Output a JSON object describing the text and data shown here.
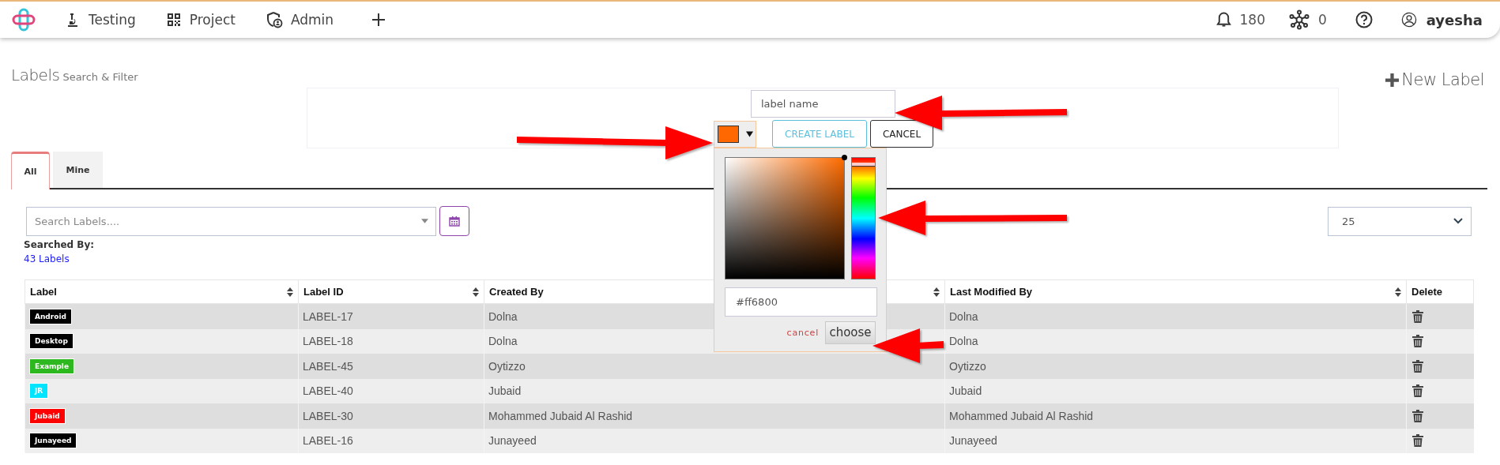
{
  "nav": {
    "items": [
      {
        "label": "Testing"
      },
      {
        "label": "Project"
      },
      {
        "label": "Admin"
      }
    ],
    "notifications": "180",
    "network_count": "0",
    "user": "ayesha"
  },
  "header": {
    "title": "Labels",
    "subtitle": "Search & Filter",
    "new_button": "New Label"
  },
  "create_form": {
    "name_field": {
      "placeholder": "label name"
    },
    "create_button": "CREATE LABEL",
    "cancel_button": "CANCEL"
  },
  "color_picker": {
    "value": "#ff6800",
    "hue_slider": {
      "level": 0.07
    },
    "cancel": "cancel",
    "choose": "choose"
  },
  "tabs": [
    {
      "label": "All",
      "selected": true
    },
    {
      "label": "Mine",
      "selected": false
    }
  ],
  "search": {
    "placeholder": "Search Labels...."
  },
  "per_page": "25",
  "searched_by": "Searched By:",
  "count_link": "43 Labels",
  "table": {
    "columns": [
      {
        "label": "Label",
        "sortable": true
      },
      {
        "label": "Label ID",
        "sortable": true
      },
      {
        "label": "Created By",
        "sortable": true
      },
      {
        "label": "Last Modified By",
        "sortable": true
      },
      {
        "label": "Delete",
        "sortable": false
      }
    ],
    "rows": [
      {
        "label": "Android",
        "color": "#000000",
        "id": "LABEL-17",
        "created_by": "Dolna",
        "modified_by": "Dolna"
      },
      {
        "label": "Desktop",
        "color": "#000000",
        "id": "LABEL-18",
        "created_by": "Dolna",
        "modified_by": "Dolna"
      },
      {
        "label": "Example",
        "color": "#2cb81e",
        "id": "LABEL-45",
        "created_by": "Oytizzo",
        "modified_by": "Oytizzo"
      },
      {
        "label": "JR",
        "color": "#00e5ff",
        "id": "LABEL-40",
        "created_by": "Jubaid",
        "modified_by": "Jubaid"
      },
      {
        "label": "Jubaid",
        "color": "#ff0000",
        "id": "LABEL-30",
        "created_by": "Mohammed Jubaid Al Rashid",
        "modified_by": "Mohammed Jubaid Al Rashid"
      },
      {
        "label": "Junayeed",
        "color": "#000000",
        "id": "LABEL-16",
        "created_by": "Junayeed",
        "modified_by": "Junayeed"
      }
    ]
  }
}
